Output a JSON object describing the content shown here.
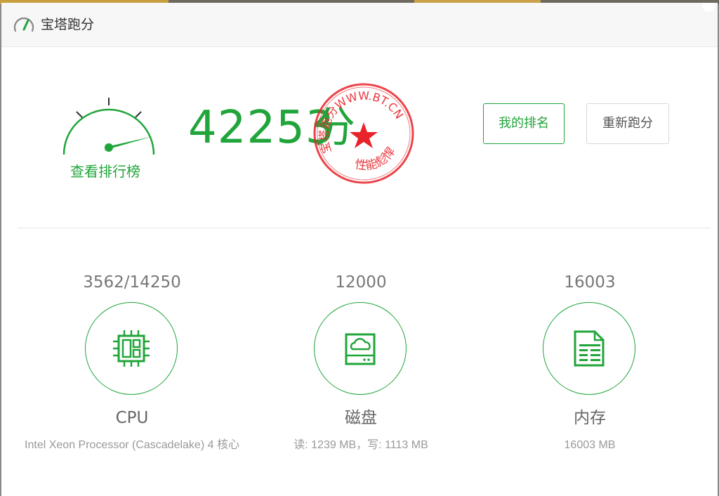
{
  "window": {
    "title": "宝塔跑分"
  },
  "score": {
    "value": "42253",
    "unit": "分",
    "rank_link": "查看排行榜"
  },
  "seal": {
    "top_text": "宝塔跑分WWW.BT.CN",
    "bottom_text": "性能彪悍"
  },
  "buttons": {
    "my_rank": "我的排名",
    "retest": "重新跑分"
  },
  "metrics": [
    {
      "id": "cpu",
      "value": "3562/14250",
      "name": "CPU",
      "description": "Intel Xeon Processor (Cascadelake) 4 核心",
      "icon": "cpu-chip-icon"
    },
    {
      "id": "disk",
      "value": "12000",
      "name": "磁盘",
      "description": "读: 1239 MB，写: 1113 MB",
      "icon": "disk-drive-icon"
    },
    {
      "id": "memory",
      "value": "16003",
      "name": "内存",
      "description": "16003 MB",
      "icon": "memory-sheet-icon"
    }
  ],
  "colors": {
    "accent": "#20a53a",
    "seal_red": "#e8232a"
  }
}
